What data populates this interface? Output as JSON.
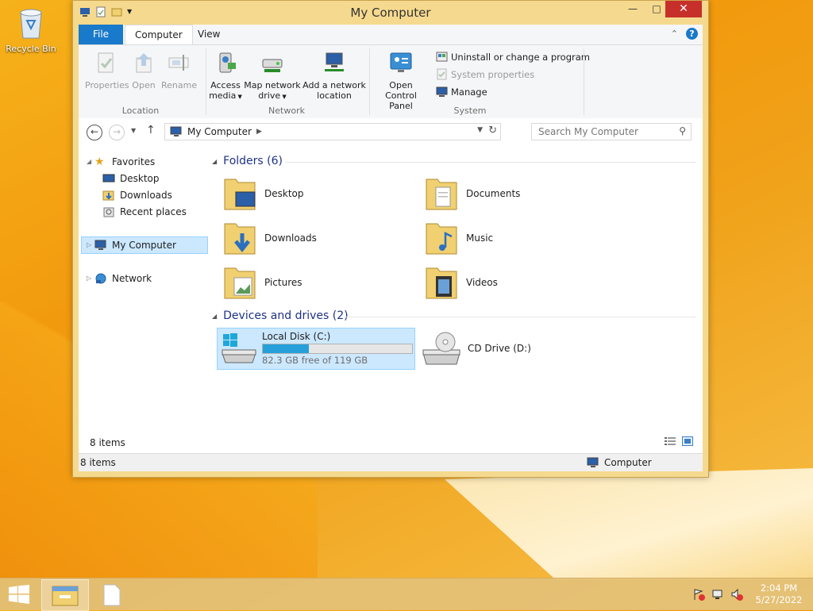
{
  "desktop": {
    "recycle_bin_label": "Recycle Bin"
  },
  "window": {
    "title": "My Computer",
    "tabs": [
      "File",
      "Computer",
      "View"
    ]
  },
  "ribbon": {
    "location": {
      "label": "Location",
      "properties": "Properties",
      "open": "Open",
      "rename": "Rename"
    },
    "network": {
      "label": "Network",
      "access_media_1": "Access",
      "access_media_2": "media",
      "map_drive_1": "Map network",
      "map_drive_2": "drive",
      "add_location_1": "Add a network",
      "add_location_2": "location"
    },
    "system": {
      "label": "System",
      "control_panel_1": "Open Control",
      "control_panel_2": "Panel",
      "uninstall": "Uninstall or change a program",
      "system_properties": "System properties",
      "manage": "Manage"
    }
  },
  "navbar": {
    "address": "My Computer",
    "search_placeholder": "Search My Computer"
  },
  "tree": {
    "favorites": "Favorites",
    "desktop": "Desktop",
    "downloads": "Downloads",
    "recent": "Recent places",
    "my_computer": "My Computer",
    "network": "Network"
  },
  "folders": {
    "header": "Folders (6)",
    "items": [
      "Desktop",
      "Documents",
      "Downloads",
      "Music",
      "Pictures",
      "Videos"
    ]
  },
  "devices": {
    "header": "Devices and drives (2)",
    "local_disk": {
      "name": "Local Disk (C:)",
      "free_text": "82.3 GB free of 119 GB",
      "used_fraction": 0.31
    },
    "cd_drive": "CD Drive (D:)"
  },
  "content_status": "8 items",
  "statusbar": {
    "left": "8 items",
    "right": "Computer"
  },
  "clock": {
    "time": "2:04 PM",
    "date": "5/27/2022"
  },
  "colors": {
    "accent": "#1979ca",
    "selection": "#cce8ff",
    "drive_fill": "#26a0da",
    "close": "#c7302a"
  }
}
